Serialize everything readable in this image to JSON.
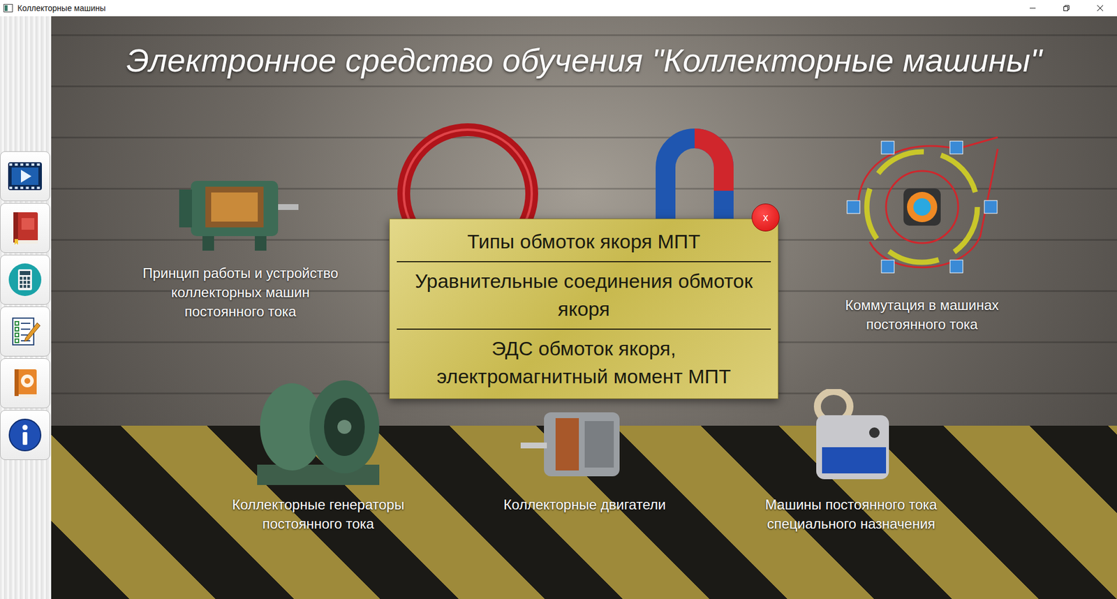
{
  "window": {
    "title": "Коллекторные машины"
  },
  "sidebar": {
    "items": [
      {
        "kind": "video"
      },
      {
        "kind": "book"
      },
      {
        "kind": "calculator"
      },
      {
        "kind": "test"
      },
      {
        "kind": "help"
      },
      {
        "kind": "info"
      }
    ]
  },
  "heading": "Электронное средство обучения \"Коллекторные машины\"",
  "tiles_top": [
    {
      "kind": "motor",
      "lines": [
        "Принцип работы и устройство",
        "коллекторных машин",
        "постоянного тока"
      ]
    },
    {
      "kind": "coil",
      "lines": []
    },
    {
      "kind": "magnet",
      "lines": []
    },
    {
      "kind": "commutation",
      "lines": [
        "Коммутация в машинах",
        "постоянного тока"
      ]
    }
  ],
  "tiles_bottom": [
    {
      "kind": "generator",
      "lines": [
        "Коллекторные генераторы",
        "постоянного тока"
      ]
    },
    {
      "kind": "drive",
      "lines": [
        "Коллекторные двигатели"
      ]
    },
    {
      "kind": "tacho",
      "lines": [
        "Машины постоянного тока",
        "специального назначения"
      ]
    }
  ],
  "popup": {
    "close": "x",
    "items": [
      {
        "lines": [
          "Типы обмоток якоря МПТ"
        ]
      },
      {
        "lines": [
          "Уравнительные соединения обмоток",
          "якоря"
        ]
      },
      {
        "lines": [
          "ЭДС обмоток якоря,",
          "электромагнитный момент МПТ"
        ]
      }
    ]
  }
}
